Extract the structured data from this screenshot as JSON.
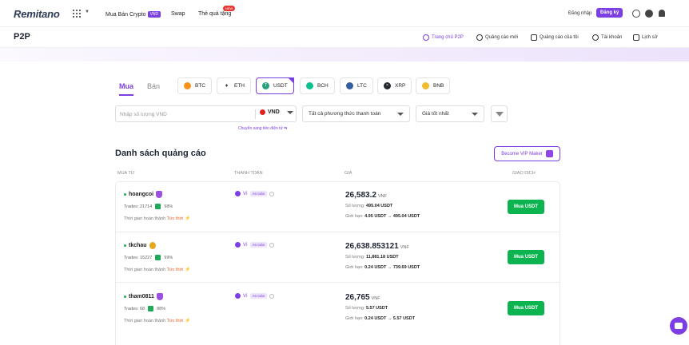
{
  "nav": {
    "logo": "Remitano",
    "buy_sell_label": "Mua Bán Crypto",
    "buy_sell_badge": "VND",
    "swap_label": "Swap",
    "gift_label": "Thẻ quà tặng",
    "gift_badge": "NEW",
    "login_label": "Đăng nhập",
    "signup_label": "Đăng ký"
  },
  "p2p": {
    "title": "P2P",
    "links": [
      "Trang chủ P2P",
      "Quảng cáo mới",
      "Quảng cáo của tôi",
      "Tài khoản",
      "Lịch sử"
    ]
  },
  "tabs": {
    "buy": "Mua",
    "sell": "Bán"
  },
  "coins": [
    {
      "label": "BTC",
      "color": "#f7931a"
    },
    {
      "label": "ETH",
      "color": "#444444"
    },
    {
      "label": "USDT",
      "color": "#26a17b"
    },
    {
      "label": "BCH",
      "color": "#0ac18e"
    },
    {
      "label": "LTC",
      "color": "#345d9d"
    },
    {
      "label": "XRP",
      "color": "#23292f"
    },
    {
      "label": "BNB",
      "color": "#f3ba2f"
    }
  ],
  "filters": {
    "amount_placeholder": "Nhập số lượng VND",
    "currency": "VND",
    "payment_method": "Tất cả phương thức thanh toán",
    "sort": "Giá tốt nhất",
    "convert_link": "Chuyển sang tiền điện tử"
  },
  "list": {
    "title": "Danh sách quảng cáo",
    "vip_button": "Become VIP Maker",
    "columns": [
      "Mua từ",
      "Thanh toán",
      "Giá",
      "Giao dịch"
    ]
  },
  "offers": [
    {
      "user": "hoangcoi",
      "badge": "purple",
      "trades": "Trades: 21714",
      "rating": "98%",
      "time_label": "Thời gian hoàn thành",
      "time_value": "Tức thời",
      "pay_method": "Ví",
      "pay_tag": "An toàn",
      "price": "26,583.2",
      "price_unit": "VNF",
      "amount_label": "Số lượng:",
      "amount": "495.04 USDT",
      "limit_label": "Giới hạn:",
      "limit": "4.95 USDT → 495.04 USDT",
      "button": "Mua USDT"
    },
    {
      "user": "tkchau",
      "badge": "gold",
      "trades": "Trades: 15227",
      "rating": "99%",
      "time_label": "Thời gian hoàn thành",
      "time_value": "Tức thời",
      "pay_method": "Ví",
      "pay_tag": "An toàn",
      "price": "26,638.853121",
      "price_unit": "VNF",
      "amount_label": "Số lượng:",
      "amount": "11,881.18 USDT",
      "limit_label": "Giới hạn:",
      "limit": "0.24 USDT → 739.69 USDT",
      "button": "Mua USDT"
    },
    {
      "user": "tham0811",
      "badge": "purple",
      "trades": "Trades: 68",
      "rating": "88%",
      "time_label": "Thời gian hoàn thành",
      "time_value": "Tức thời",
      "pay_method": "Ví",
      "pay_tag": "An toàn",
      "price": "26,765",
      "price_unit": "VNF",
      "amount_label": "Số lượng:",
      "amount": "5.57 USDT",
      "limit_label": "Giới hạn:",
      "limit": "0.24 USDT → 5.57 USDT",
      "button": "Mua USDT"
    }
  ]
}
